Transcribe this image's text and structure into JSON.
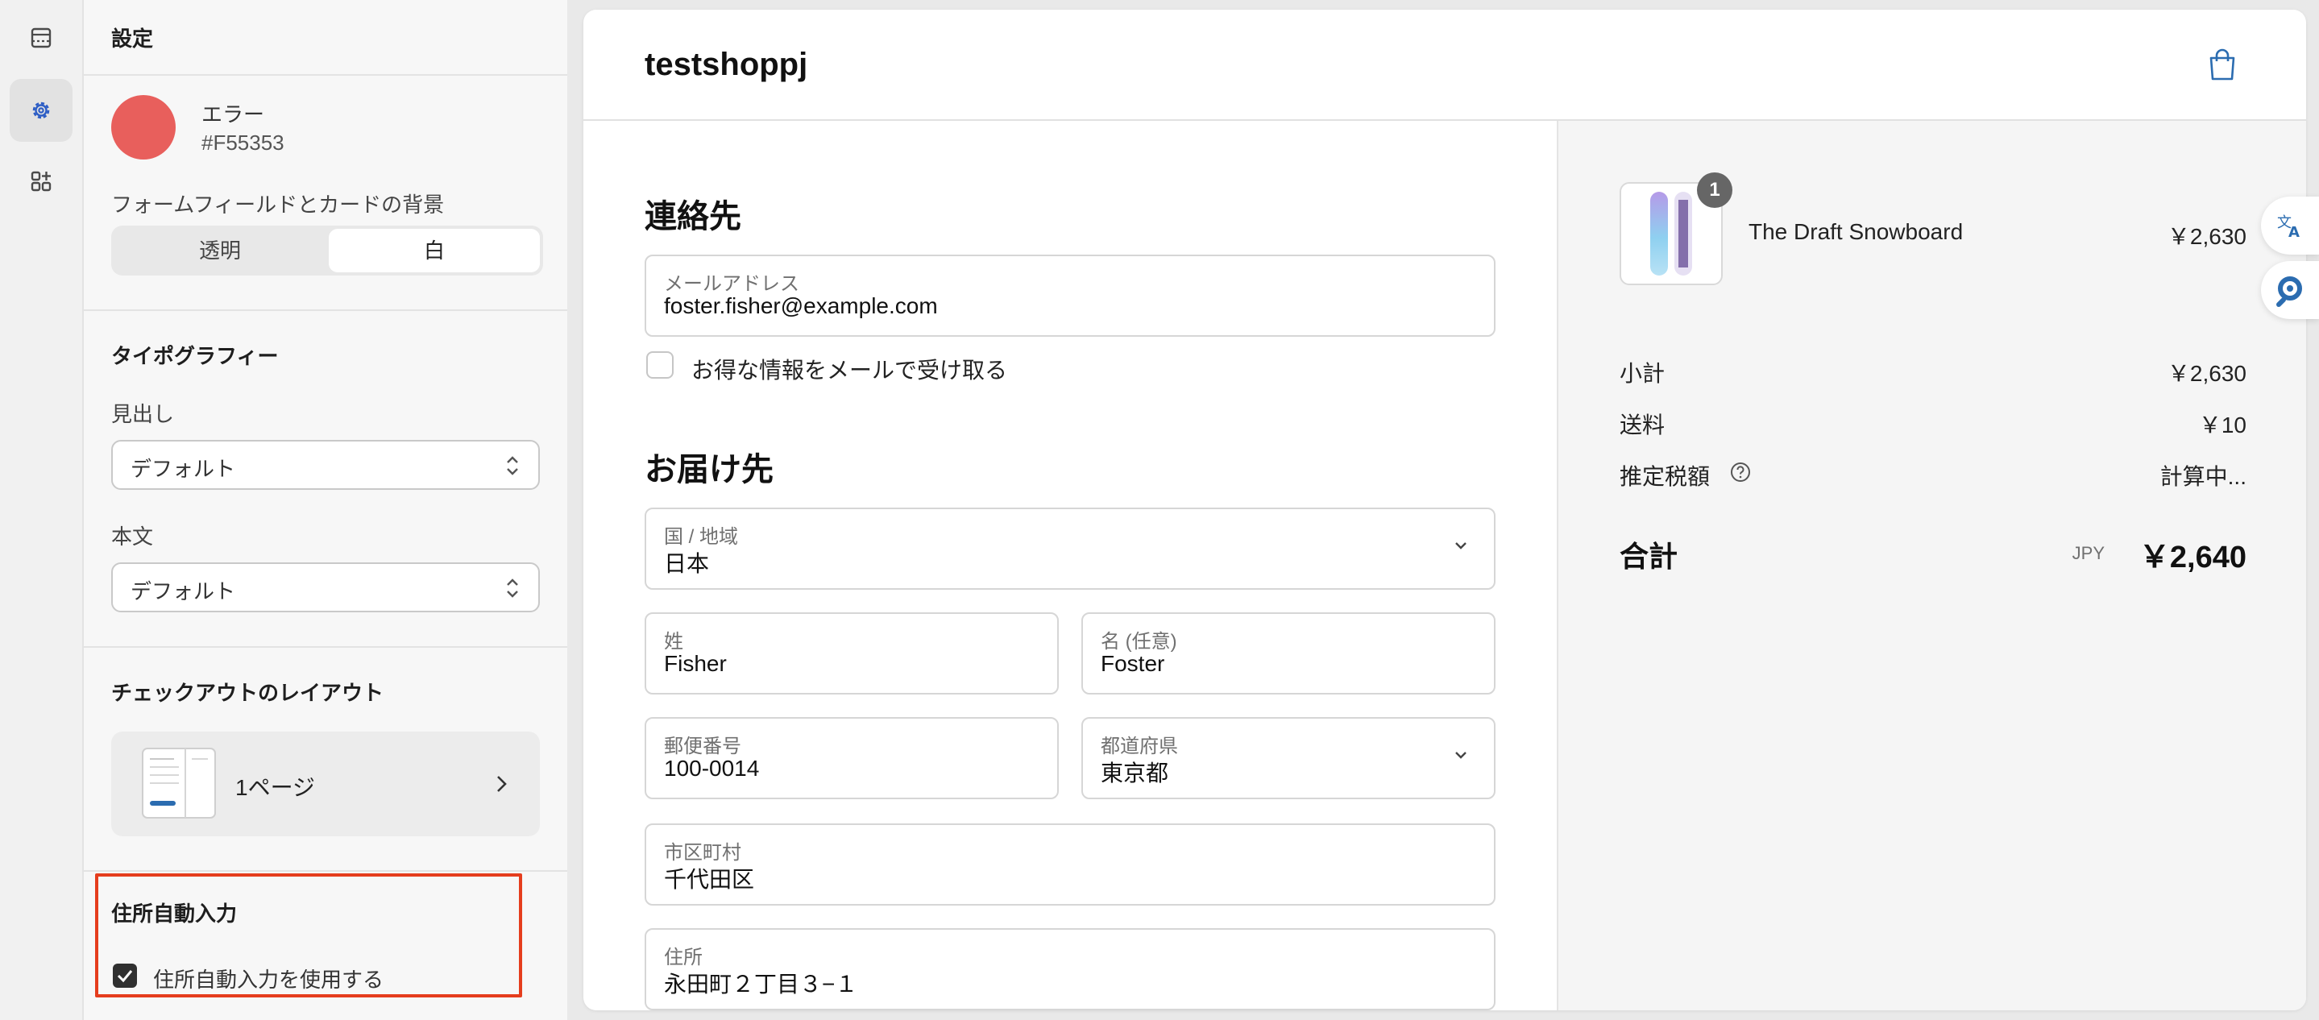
{
  "settings_panel": {
    "title": "設定",
    "error_color": {
      "label": "エラー",
      "hex": "#F55353",
      "swatch": "#E85F5C"
    },
    "background_label": "フォームフィールドとカードの背景",
    "background_options": [
      "透明",
      "白"
    ],
    "background_selected": "白",
    "typography": {
      "title": "タイポグラフィー",
      "heading_label": "見出し",
      "heading_value": "デフォルト",
      "body_label": "本文",
      "body_value": "デフォルト"
    },
    "layout": {
      "title": "チェックアウトのレイアウト",
      "value": "1ページ"
    },
    "autocomplete": {
      "title": "住所自動入力",
      "checkbox_label": "住所自動入力を使用する",
      "checked": true
    }
  },
  "header": {
    "shop_name": "testshoppj",
    "cart_icon": "shopping-bag-icon"
  },
  "contact": {
    "title": "連絡先",
    "email_label": "メールアドレス",
    "email_value": "foster.fisher@example.com",
    "newsletter_label": "お得な情報をメールで受け取る"
  },
  "delivery": {
    "title": "お届け先",
    "country_label": "国 / 地域",
    "country_value": "日本",
    "last_name_label": "姓",
    "last_name_value": "Fisher",
    "first_name_label": "名 (任意)",
    "first_name_value": "Foster",
    "postal_label": "郵便番号",
    "postal_value": "100-0014",
    "prefecture_label": "都道府県",
    "prefecture_value": "東京都",
    "city_label": "市区町村",
    "city_value": "千代田区",
    "address_label": "住所",
    "address_value": "永田町２丁目３−１"
  },
  "summary": {
    "item": {
      "name": "The Draft Snowboard",
      "price": "￥2,630",
      "quantity": "1"
    },
    "subtotal_label": "小計",
    "subtotal_value": "￥2,630",
    "shipping_label": "送料",
    "shipping_value": "￥10",
    "tax_label": "推定税額",
    "tax_value": "計算中...",
    "total_label": "合計",
    "currency": "JPY",
    "total_value": "￥2,640"
  },
  "colors": {
    "accent": "#2B6CB0",
    "highlight": "#E53D1D",
    "checkbox": "#303030"
  }
}
